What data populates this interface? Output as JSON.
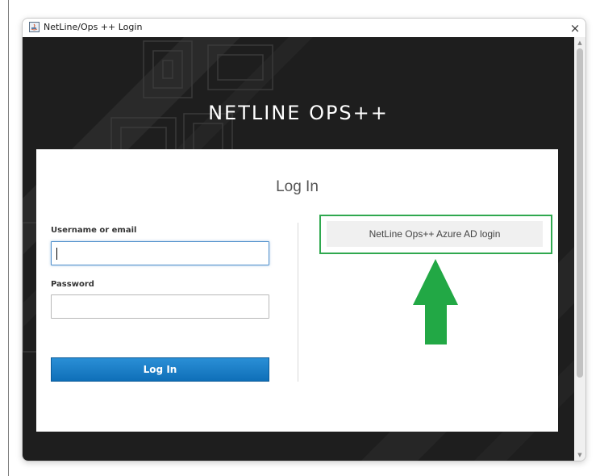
{
  "window": {
    "title": "NetLine/Ops ++ Login",
    "close_symbol": "×"
  },
  "brand": {
    "title": "NETLINE OPS++"
  },
  "login_card": {
    "heading": "Log In",
    "username_label": "Username or email",
    "username_value": "",
    "password_label": "Password",
    "password_value": "",
    "login_button": "Log In",
    "azure_button": "NetLine Ops++ Azure AD login"
  },
  "scrollbar": {
    "up_symbol": "▲",
    "down_symbol": "▼"
  },
  "annotation": {
    "highlight_color": "#2fa84f",
    "arrow_color": "#22a845",
    "arrow_icon": "arrow-up-icon"
  },
  "colors": {
    "background_dark": "#1e1e1e",
    "login_button": "#1a7dc6",
    "input_focus": "#4f8fcb"
  }
}
